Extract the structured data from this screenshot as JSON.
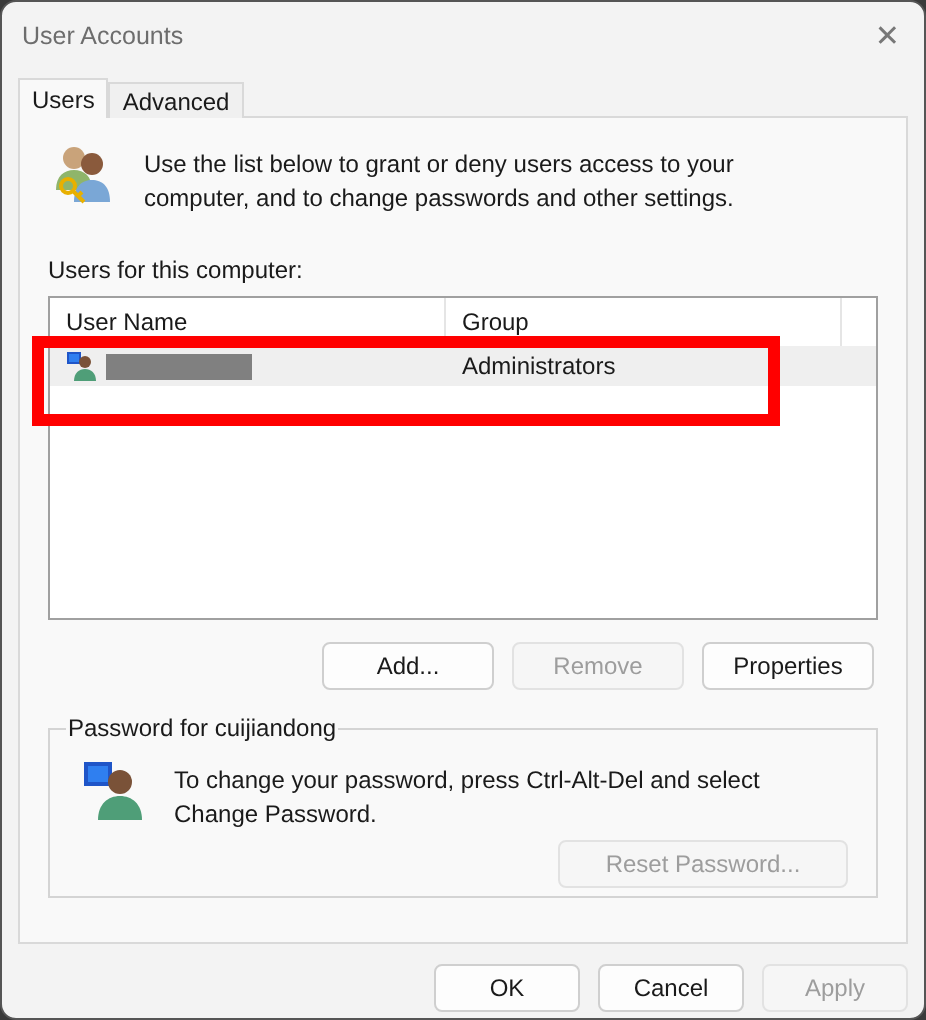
{
  "window": {
    "title": "User Accounts",
    "close": "✕"
  },
  "tabs": [
    {
      "label": "Users",
      "selected": true
    },
    {
      "label": "Advanced",
      "selected": false
    }
  ],
  "intro": "Use the list below to grant or deny users access to your computer, and to change passwords and other settings.",
  "users_label": "Users for this computer:",
  "table": {
    "columns": [
      "User Name",
      "Group"
    ],
    "rows": [
      {
        "name_redacted": true,
        "group": "Administrators",
        "selected": true
      }
    ]
  },
  "highlight": {
    "color": "#ff0000"
  },
  "list_buttons": [
    {
      "label": "Add...",
      "disabled": false
    },
    {
      "label": "Remove",
      "disabled": true
    },
    {
      "label": "Properties",
      "disabled": false
    }
  ],
  "password": {
    "legend": "Password for cuijiandong",
    "text": "To change your password, press Ctrl-Alt-Del and select Change Password.",
    "button": {
      "label": "Reset Password...",
      "disabled": true
    }
  },
  "footer_buttons": [
    {
      "label": "OK",
      "disabled": false
    },
    {
      "label": "Cancel",
      "disabled": false
    },
    {
      "label": "Apply",
      "disabled": true
    }
  ]
}
